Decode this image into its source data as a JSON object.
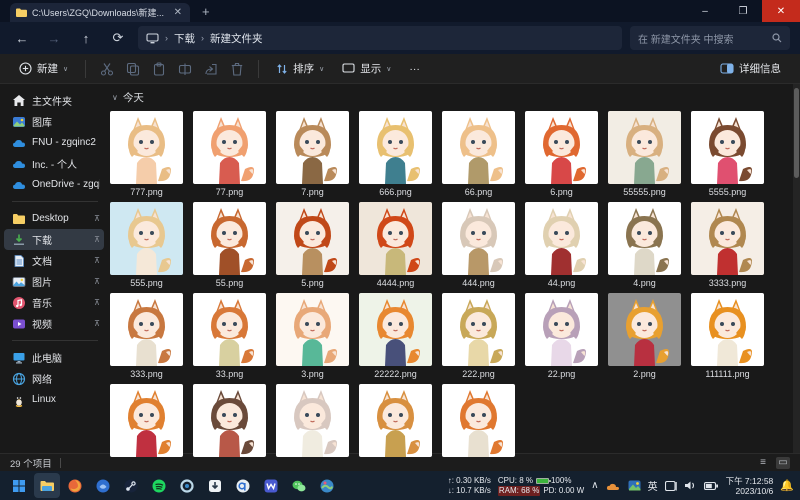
{
  "window": {
    "tab_title": "C:\\Users\\ZGQ\\Downloads\\新建...",
    "tab_close": "✕",
    "new_tab": "+",
    "minimize": "–",
    "maximize": "❐",
    "close": "✕"
  },
  "nav": {
    "back": "←",
    "forward": "→",
    "up": "↑",
    "refresh": "⟳",
    "breadcrumb": [
      "下载",
      "新建文件夹"
    ],
    "crumb_sep": "›",
    "search_placeholder": "在 新建文件夹 中搜索",
    "search_icon": "🔍"
  },
  "toolbar": {
    "new_label": "新建",
    "sort_label": "排序",
    "view_label": "显示",
    "more_label": "···",
    "details_label": "详细信息",
    "chevron": "∨"
  },
  "sidebar": {
    "sections": [
      {
        "items": [
          {
            "label": "主文件夹",
            "icon": "home",
            "pinned": false,
            "selected": false
          },
          {
            "label": "图库",
            "icon": "gallery",
            "pinned": false,
            "selected": false
          },
          {
            "label": "FNU - zgqinc2",
            "icon": "cloud",
            "pinned": false,
            "selected": false
          },
          {
            "label": "Inc. - 个人",
            "icon": "cloud",
            "pinned": false,
            "selected": false
          },
          {
            "label": "OneDrive - zgqinc",
            "icon": "cloud",
            "pinned": false,
            "selected": false
          }
        ]
      },
      {
        "items": [
          {
            "label": "Desktop",
            "icon": "folder",
            "pinned": true,
            "selected": false
          },
          {
            "label": "下载",
            "icon": "download",
            "pinned": true,
            "selected": true
          },
          {
            "label": "文档",
            "icon": "document",
            "pinned": true,
            "selected": false
          },
          {
            "label": "图片",
            "icon": "pictures",
            "pinned": true,
            "selected": false
          },
          {
            "label": "音乐",
            "icon": "music",
            "pinned": true,
            "selected": false
          },
          {
            "label": "视频",
            "icon": "videos",
            "pinned": true,
            "selected": false
          }
        ]
      },
      {
        "items": [
          {
            "label": "此电脑",
            "icon": "pc",
            "pinned": false,
            "selected": false
          },
          {
            "label": "网络",
            "icon": "network",
            "pinned": false,
            "selected": false
          },
          {
            "label": "Linux",
            "icon": "linux",
            "pinned": false,
            "selected": false
          }
        ]
      }
    ],
    "pin_glyph": "⊼"
  },
  "content": {
    "group_label": "今天",
    "group_chevron": "∨",
    "files": [
      {
        "name": "777.png",
        "bg": "#ffffff",
        "hair": "#e9bd85",
        "dress": "#f5cdaa"
      },
      {
        "name": "77.png",
        "bg": "#ffffff",
        "hair": "#f0a070",
        "dress": "#d85c50"
      },
      {
        "name": "7.png",
        "bg": "#ffffff",
        "hair": "#b98a5a",
        "dress": "#8a6844"
      },
      {
        "name": "666.png",
        "bg": "#ffffff",
        "hair": "#e8c070",
        "dress": "#3f7f8f"
      },
      {
        "name": "66.png",
        "bg": "#ffffff",
        "hair": "#eec08a",
        "dress": "#b09a6a"
      },
      {
        "name": "6.png",
        "bg": "#ffffff",
        "hair": "#e06830",
        "dress": "#d84848"
      },
      {
        "name": "55555.png",
        "bg": "#f2ede4",
        "hair": "#d8b080",
        "dress": "#88a890"
      },
      {
        "name": "5555.png",
        "bg": "#ffffff",
        "hair": "#7a4a30",
        "dress": "#e05070"
      },
      {
        "name": "555.png",
        "bg": "#cfe8f2",
        "hair": "#e8c890",
        "dress": "#f5e8d8"
      },
      {
        "name": "55.png",
        "bg": "#ffffff",
        "hair": "#c86830",
        "dress": "#a05028"
      },
      {
        "name": "5.png",
        "bg": "#f5f0ea",
        "hair": "#c04818",
        "dress": "#b89060"
      },
      {
        "name": "4444.png",
        "bg": "#efe6da",
        "hair": "#d04818",
        "dress": "#c8b87a"
      },
      {
        "name": "444.png",
        "bg": "#ffffff",
        "hair": "#d8c8b8",
        "dress": "#b89868"
      },
      {
        "name": "44.png",
        "bg": "#ffffff",
        "hair": "#e0d0b0",
        "dress": "#a03030"
      },
      {
        "name": "4.png",
        "bg": "#ffffff",
        "hair": "#8a7450",
        "dress": "#ded8c8"
      },
      {
        "name": "3333.png",
        "bg": "#f5eee6",
        "hair": "#b08850",
        "dress": "#c03030"
      },
      {
        "name": "333.png",
        "bg": "#ffffff",
        "hair": "#c87840",
        "dress": "#e8e0d0"
      },
      {
        "name": "33.png",
        "bg": "#ffffff",
        "hair": "#d87838",
        "dress": "#d8d0a0"
      },
      {
        "name": "3.png",
        "bg": "#fdf8f2",
        "hair": "#e8a878",
        "dress": "#58b898"
      },
      {
        "name": "22222.png",
        "bg": "#eef3e8",
        "hair": "#e88830",
        "dress": "#48507a"
      },
      {
        "name": "222.png",
        "bg": "#ffffff",
        "hair": "#c8a858",
        "dress": "#e8d8a8"
      },
      {
        "name": "22.png",
        "bg": "#ffffff",
        "hair": "#b8a0b8",
        "dress": "#e8d8e8"
      },
      {
        "name": "2.png",
        "bg": "#909090",
        "hair": "#e8a030",
        "dress": "#b83040"
      },
      {
        "name": "111111.png",
        "bg": "#ffffff",
        "hair": "#e89020",
        "dress": "#f0e8d8"
      },
      {
        "name": "",
        "bg": "#ffffff",
        "hair": "#e08030",
        "dress": "#c03040"
      },
      {
        "name": "",
        "bg": "#ffffff",
        "hair": "#6a4a3a",
        "dress": "#b85848"
      },
      {
        "name": "",
        "bg": "#ffffff",
        "hair": "#d8c8c0",
        "dress": "#f0ece0"
      },
      {
        "name": "",
        "bg": "#ffffff",
        "hair": "#d89040",
        "dress": "#c8a050"
      },
      {
        "name": "",
        "bg": "#ffffff",
        "hair": "#e07830",
        "dress": "#e8e0d0"
      }
    ]
  },
  "statusbar": {
    "items_count": "29 个项目"
  },
  "taskbar": {
    "apps": [
      {
        "icon": "start",
        "active": false
      },
      {
        "icon": "explorer",
        "active": true
      },
      {
        "icon": "firefox",
        "active": false
      },
      {
        "icon": "files-app",
        "active": false
      },
      {
        "icon": "steam",
        "active": false
      },
      {
        "icon": "spotify",
        "active": false
      },
      {
        "icon": "ring-app",
        "active": false
      },
      {
        "icon": "downloader",
        "active": false
      },
      {
        "icon": "qbittorrent",
        "active": false
      },
      {
        "icon": "w-app",
        "active": false
      },
      {
        "icon": "wechat",
        "active": false
      },
      {
        "icon": "globe-app",
        "active": false
      }
    ],
    "stats": {
      "up": "↑: 0.30 KB/s",
      "down": "↓: 10.7 KB/s",
      "cpu": "CPU: 8 %",
      "cpu_pct": "100%",
      "ram": "RAM: 68 %",
      "pd": "PD: 0.00 W"
    },
    "tray_chevron": "∧",
    "ime": "英",
    "clock": {
      "time": "下午 7:12:58",
      "date": "2023/10/6"
    }
  },
  "colors": {
    "accent_close": "#c42b1c",
    "titlebar": "#0c1322",
    "selection": "#333a44",
    "battery_green": "#3db53d",
    "ram_highlight": "#6e2020"
  }
}
